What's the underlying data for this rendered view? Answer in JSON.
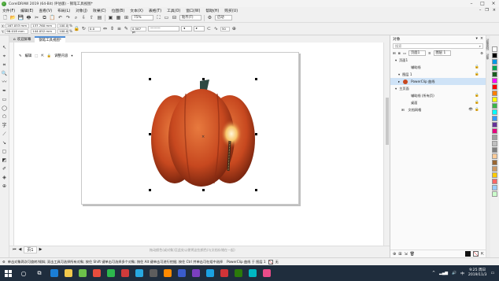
{
  "window": {
    "title": "CorelDRAW 2019 (64-Bit) 评估版) - 钢笔工具视图*"
  },
  "menu": [
    "文件(F)",
    "编辑(E)",
    "查看(V)",
    "布局(L)",
    "对象(J)",
    "效果(C)",
    "位图(B)",
    "文本(X)",
    "表格(T)",
    "工具(O)",
    "窗口(W)",
    "帮助(H)",
    "购买(U)"
  ],
  "std_toolbar": {
    "zoom": "75%",
    "snap_label": "贴齐(T)",
    "launch_label": "启动"
  },
  "property_bar": {
    "x_label": "X:",
    "x_value": "167.053 mm",
    "y_label": "Y:",
    "y_value": "96.018 mm",
    "w_value": "137.760 mm",
    "h_value": "144.052 mm",
    "scale_x": "100.0",
    "scale_y": "100.0",
    "percent": "%",
    "angle": "0.0",
    "outline_width": "0.567 pt",
    "number": "50"
  },
  "tabs": {
    "welcome": "欢迎屏幕",
    "document": "钢笔工具视图*"
  },
  "context_toolbar": {
    "edit": "编辑",
    "adjust": "调整内容"
  },
  "pagebar": {
    "page": "页1",
    "hint": "拖动颜色(或对象)至此处以便将这些颜色(与文档存储在一起)"
  },
  "status": {
    "message": "单击对象两次可旋转/倾斜; 双击工具可选择所有对象; 按住 Shift 键单击可选择多个对象; 按住 Alt 键单击可进行挖掘; 按住 Ctrl 并单击可在组中选择",
    "object": "PowerClip 曲线 于 图层 1",
    "fill": "无"
  },
  "docker": {
    "title": "对象",
    "search_placeholder": "搜索",
    "page_dropdown": "页面1",
    "layer_dropdown": "图层 1",
    "rows": [
      {
        "label": "页面1"
      },
      {
        "label": "辅助线"
      },
      {
        "label": "图层 1"
      },
      {
        "label": "PowerClip 曲线"
      },
      {
        "label": "主页面"
      },
      {
        "label": "辅助线 (所有页)"
      },
      {
        "label": "桌面"
      },
      {
        "label": "文档网格"
      }
    ]
  },
  "side_tabs": [
    "对象属性",
    "对象"
  ],
  "palette": [
    "#ffffff",
    "#000000",
    "#0099e6",
    "#00a651",
    "#1b5e20",
    "#ff00ff",
    "#ff0000",
    "#ff7f00",
    "#ffff00",
    "#39b54a",
    "#00ffff",
    "#3399ff",
    "#663399",
    "#e6007e",
    "#a0a0a0",
    "#c0c0c0",
    "#7f7f7f",
    "#ffcc99",
    "#996633",
    "#cc9966",
    "#ffcc00",
    "#ff6666",
    "#99ccff",
    "#ccffcc"
  ],
  "taskbar": {
    "time": "9:25 周日",
    "date": "2019/11/3",
    "apps": [
      {
        "name": "edge",
        "color": "#1b7fd6"
      },
      {
        "name": "explorer",
        "color": "#f2c94c"
      },
      {
        "name": "corel",
        "color": "#6cc04a"
      },
      {
        "name": "app3",
        "color": "#e84d3d"
      },
      {
        "name": "app4",
        "color": "#2db84d"
      },
      {
        "name": "app5",
        "color": "#cf3b3b"
      },
      {
        "name": "app6",
        "color": "#28a8e0"
      },
      {
        "name": "app7",
        "color": "#5d5d5d"
      },
      {
        "name": "app8",
        "color": "#ff8a00"
      },
      {
        "name": "app9",
        "color": "#3a5ccc"
      },
      {
        "name": "app10",
        "color": "#7b3fbf"
      },
      {
        "name": "app11",
        "color": "#1ba1e2"
      },
      {
        "name": "app12",
        "color": "#d13438"
      },
      {
        "name": "app13",
        "color": "#2b7a0b"
      },
      {
        "name": "app14",
        "color": "#00b7c3"
      },
      {
        "name": "app15",
        "color": "#ea4c89"
      }
    ]
  }
}
